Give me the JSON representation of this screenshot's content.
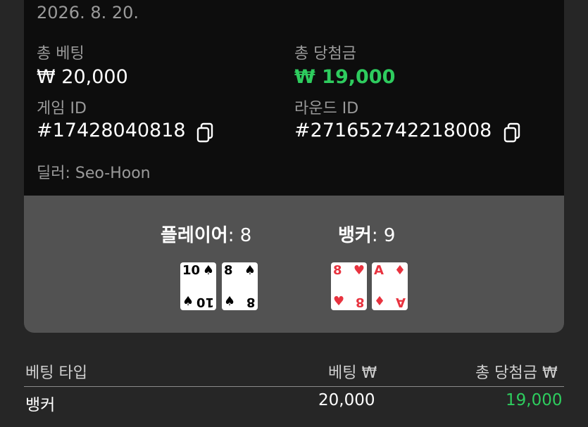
{
  "summary": {
    "date": "2026. 8. 20.",
    "total_bet_label": "총 베팅",
    "total_bet_value": "₩ 20,000",
    "total_win_label": "총 당첨금",
    "total_win_value": "₩ 19,000",
    "game_id_label": "게임 ID",
    "game_id_value": "#17428040818",
    "round_id_label": "라운드 ID",
    "round_id_value": "#271652742218008",
    "dealer": "딜러: Seo-Hoon"
  },
  "hands": {
    "player": {
      "label": "플레이어",
      "score": ": 8",
      "cards": [
        {
          "rank": "10",
          "suit": "♠",
          "color": "black"
        },
        {
          "rank": "8",
          "suit": "♠",
          "color": "black"
        }
      ]
    },
    "banker": {
      "label": "뱅커",
      "score": ": 9",
      "cards": [
        {
          "rank": "8",
          "suit": "♥",
          "color": "red"
        },
        {
          "rank": "A",
          "suit": "♦",
          "color": "red"
        }
      ]
    }
  },
  "bet_table": {
    "headers": [
      "베팅 타입",
      "베팅 ₩",
      "총 당첨금 ₩"
    ],
    "rows": [
      {
        "type": "뱅커",
        "bet": "20,000",
        "win": "19,000"
      }
    ]
  },
  "colors": {
    "win_green": "#2ecc5e",
    "panel_dark": "#0d0d0d",
    "panel_gray": "#525252",
    "card_red": "#e8333f"
  },
  "icons": {
    "copy": "copy-icon"
  }
}
